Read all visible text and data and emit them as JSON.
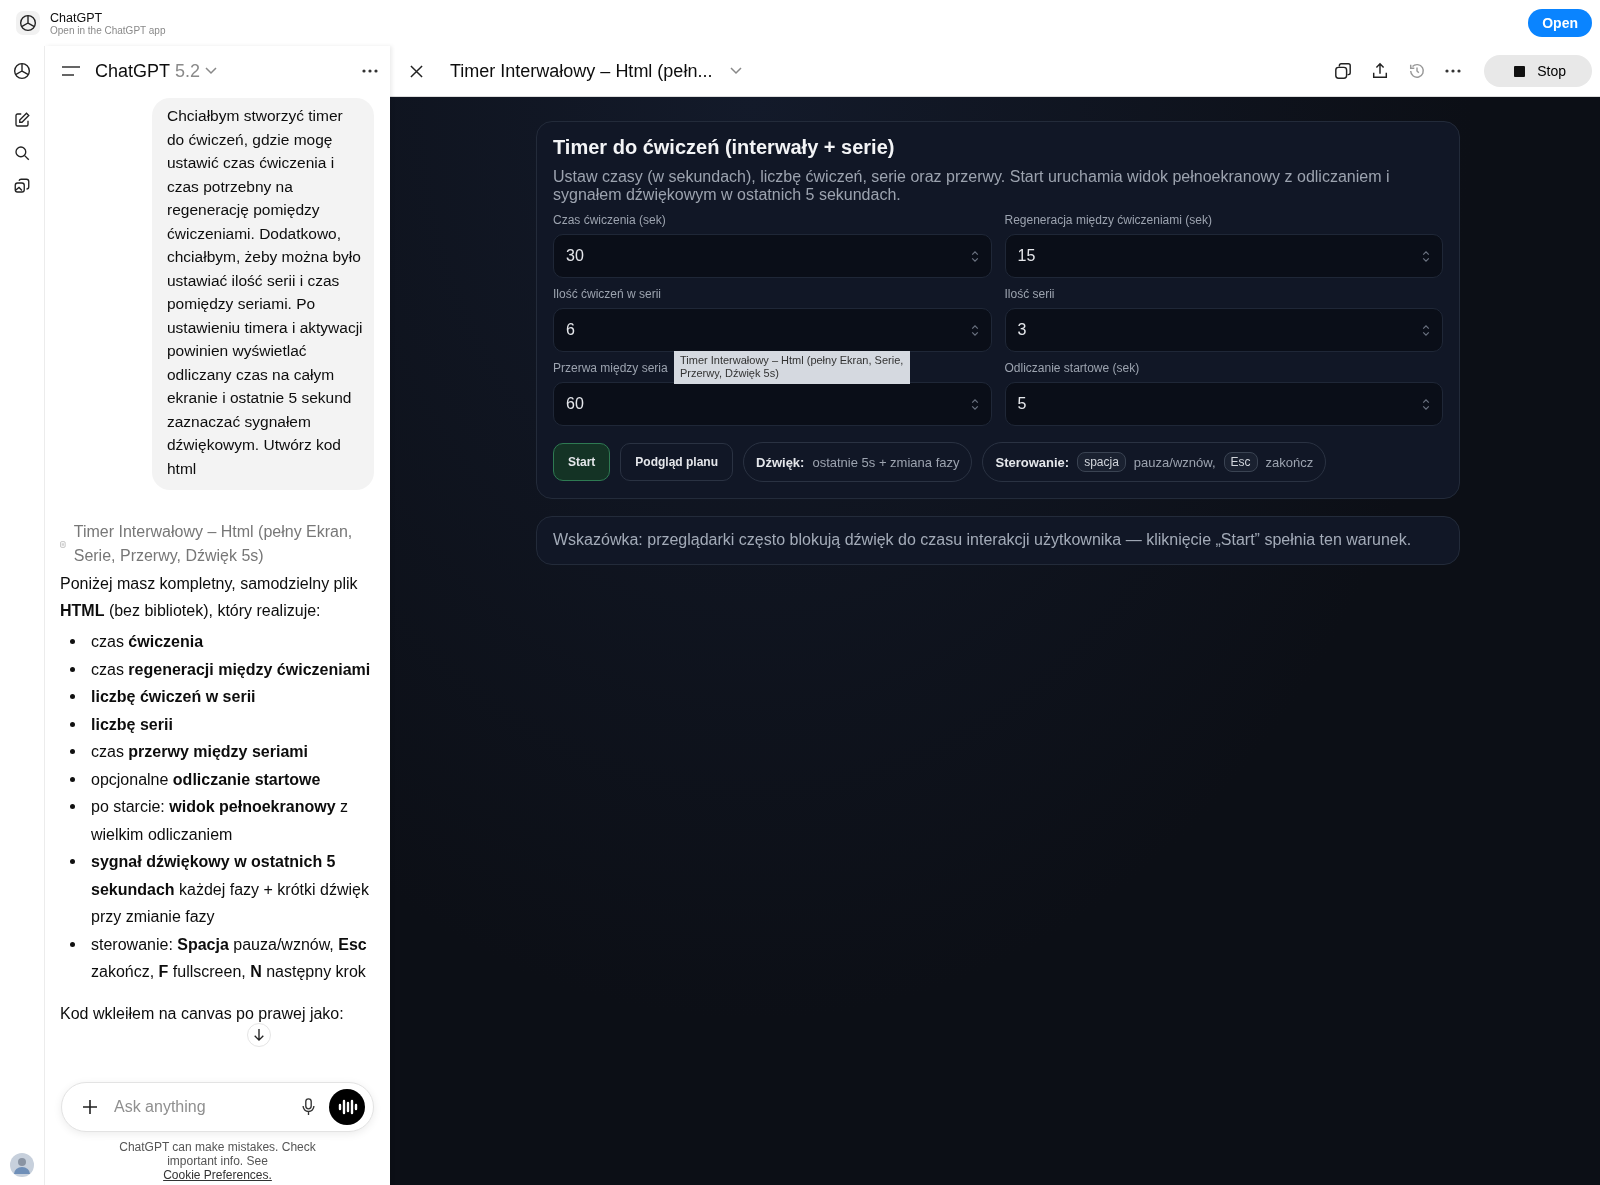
{
  "app_banner": {
    "title": "ChatGPT",
    "subtitle": "Open in the ChatGPT app",
    "button": "Open"
  },
  "chat_header": {
    "title": "ChatGPT",
    "version": "5.2"
  },
  "user_message": "Chciałbym stworzyć timer do ćwiczeń, gdzie mogę ustawić czas ćwiczenia i czas potrzebny na regenerację pomiędzy ćwiczeniami. Dodatkowo, chciałbym, żeby można było ustawiać ilość serii i czas pomiędzy seriami. Po ustawieniu timera i aktywacji powinien wyświetlać odliczany czas na całym ekranie i ostatnie 5 sekund zaznaczać sygnałem dźwiękowym. Utwórz kod html",
  "canvas_link": "Timer Interwałowy – Html (pełny Ekran, Serie, Przerwy, Dźwięk 5s)",
  "assistant": {
    "intro": "Poniżej masz kompletny, samodzielny plik **HTML** (bez bibliotek), który realizuje:",
    "bullets": [
      "czas **ćwiczenia**",
      "czas **regeneracji między ćwiczeniami**",
      "**liczbę ćwiczeń w serii**",
      "**liczbę serii**",
      "czas **przerwy między seriami**",
      "opcjonalne **odliczanie startowe**",
      "po starcie: **widok pełnoekranowy** z wielkim odliczaniem",
      "**sygnał dźwiękowy w ostatnich 5 sekundach** każdej fazy + krótki dźwięk przy zmianie fazy",
      "sterowanie: **Spacja** pauza/wznów, **Esc** zakończ, **F** fullscreen, **N** następny krok"
    ],
    "outro": "Kod wkleiłem na canvas po prawej jako:"
  },
  "composer": {
    "placeholder": "Ask anything"
  },
  "disclaimer": {
    "text": "ChatGPT can make mistakes. Check important info. See",
    "link": "Cookie Preferences."
  },
  "canvas": {
    "title": "Timer Interwałowy – Html (pełn...",
    "stop_button": "Stop"
  },
  "app": {
    "title": "Timer do ćwiczeń (interwały + serie)",
    "description": "Ustaw czasy (w sekundach), liczbę ćwiczeń, serie oraz przerwy. Start uruchamia widok pełnoekranowy z odliczaniem i sygnałem dźwiękowym w ostatnich 5 sekundach.",
    "fields": [
      {
        "label": "Czas ćwiczenia (sek)",
        "value": "30"
      },
      {
        "label": "Regeneracja między ćwiczeniami (sek)",
        "value": "15"
      },
      {
        "label": "Ilość ćwiczeń w serii",
        "value": "6"
      },
      {
        "label": "Ilość serii",
        "value": "3"
      },
      {
        "label": "Przerwa między seria",
        "value": "60"
      },
      {
        "label": "Odliczanie startowe (sek)",
        "value": "5"
      }
    ],
    "buttons": [
      {
        "label": "Start",
        "kind": "primary"
      },
      {
        "label": "Podgląd planu",
        "kind": "secondary"
      }
    ],
    "sound_pill": {
      "label": "Dźwięk:",
      "text": "ostatnie 5s + zmiana fazy"
    },
    "controls_pill": {
      "label": "Sterowanie:",
      "items": [
        {
          "key": "spacja",
          "action": "pauza/wznów,"
        },
        {
          "key": "Esc",
          "action": "zakończ"
        }
      ]
    },
    "tip": "Wskazówka: przeglądarki często blokują dźwięk do czasu interakcji użytkownika — kliknięcie „Start” spełnia ten warunek."
  },
  "tooltip": "Timer Interwałowy – Html (pełny Ekran, Serie, Przerwy, Dźwięk 5s)"
}
